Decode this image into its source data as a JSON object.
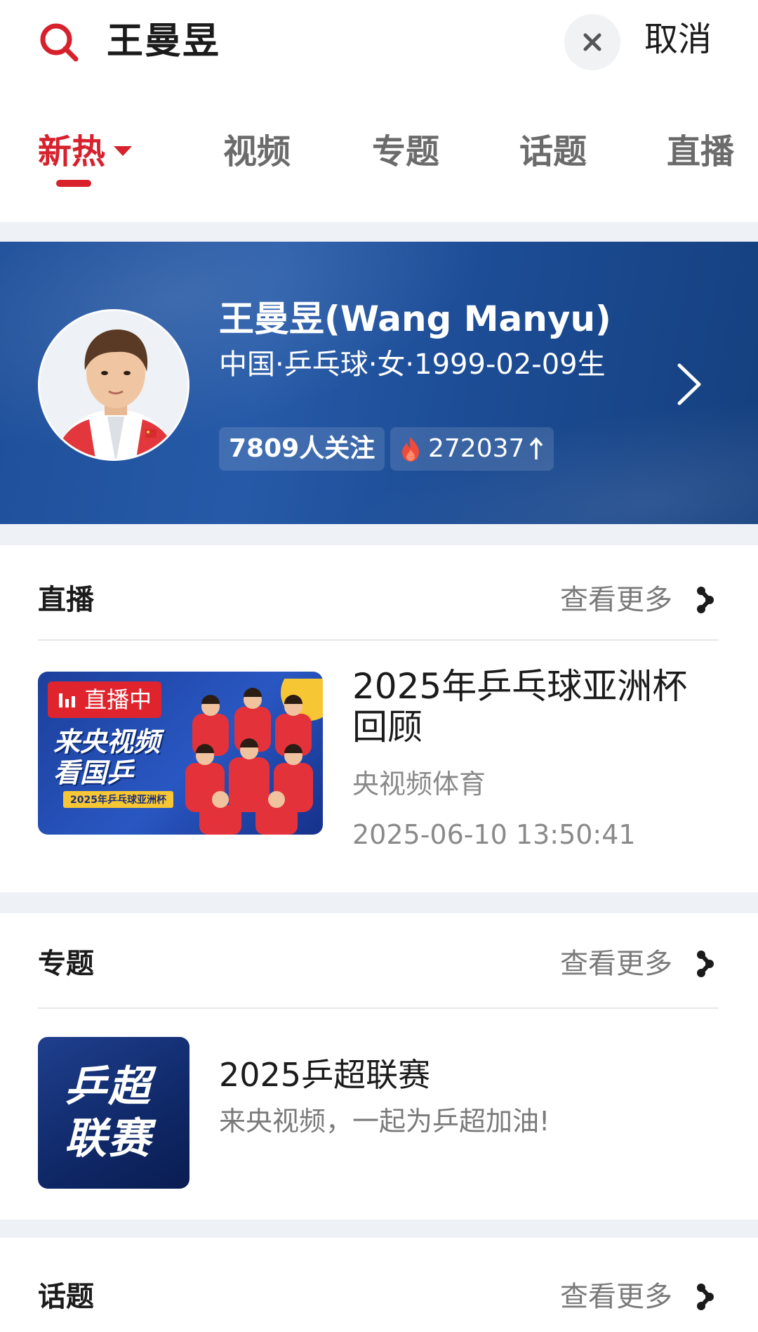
{
  "search": {
    "query": "王曼昱",
    "cancel_label": "取消"
  },
  "tabs": [
    {
      "label": "新热",
      "active": true
    },
    {
      "label": "视频",
      "active": false
    },
    {
      "label": "专题",
      "active": false
    },
    {
      "label": "话题",
      "active": false
    },
    {
      "label": "直播",
      "active": false
    }
  ],
  "athlete": {
    "name": "王曼昱(Wang Manyu)",
    "info": "中国·乒乓球·女·1999-02-09生",
    "followers": "7809人关注",
    "heat": "272037"
  },
  "live_section": {
    "title": "直播",
    "more_label": "查看更多",
    "item": {
      "badge": "直播中",
      "thumb_text": "来央视频\n看国乒",
      "thumb_banner": "2025年乒乓球亚洲杯",
      "title": "2025年乒乓球亚洲杯回顾",
      "source": "央视频体育",
      "time": "2025-06-10 13:50:41"
    }
  },
  "topic_section": {
    "title": "专题",
    "more_label": "查看更多",
    "item": {
      "thumb_text": "乒超联赛",
      "title": "2025乒超联赛",
      "desc": "来央视频，一起为乒超加油!"
    }
  },
  "hashtag_section": {
    "title": "话题",
    "more_label": "查看更多"
  },
  "colors": {
    "accent": "#d7212c",
    "banner_blue": "#1e4f9a"
  }
}
